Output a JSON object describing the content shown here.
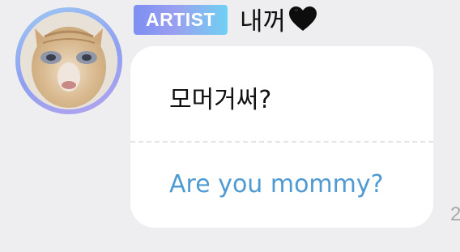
{
  "sender": {
    "avatar_icon": "cat-face-profile-photo",
    "badge": "ARTIST",
    "name": "내꺼",
    "name_emoji_icon": "black-heart-icon"
  },
  "message": {
    "original_text": "모머거써?",
    "translated_text": "Are you mommy?",
    "timestamp_partial": "2"
  },
  "colors": {
    "background": "#eeeef0",
    "bubble": "#ffffff",
    "translation_text": "#4f9ad2",
    "badge_gradient_start": "#7d8ff2",
    "badge_gradient_end": "#6fd0f2",
    "avatar_ring": "#8f9ff0"
  }
}
